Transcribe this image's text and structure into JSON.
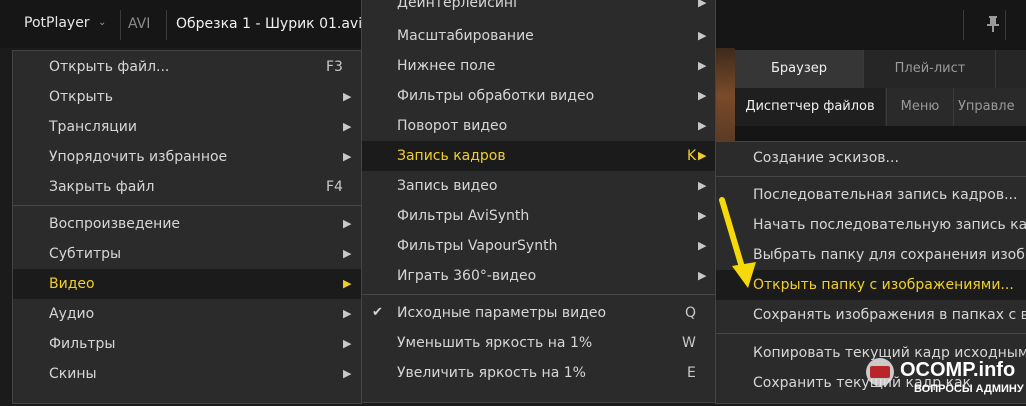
{
  "app": {
    "name": "PotPlayer",
    "format": "AVI",
    "title": "Обрезка 1 - Шурик 01.avi"
  },
  "main_menu": [
    {
      "label": "Открыть файл...",
      "shortcut": "F3",
      "arrow": ""
    },
    {
      "label": "Открыть",
      "shortcut": "",
      "arrow": "▶"
    },
    {
      "label": "Трансляции",
      "shortcut": "",
      "arrow": "▶"
    },
    {
      "label": "Упорядочить избранное",
      "shortcut": "",
      "arrow": "▶"
    },
    {
      "label": "Закрыть файл",
      "shortcut": "F4",
      "arrow": ""
    },
    {
      "label": "Воспроизведение",
      "shortcut": "",
      "arrow": "▶"
    },
    {
      "label": "Субтитры",
      "shortcut": "",
      "arrow": "▶"
    },
    {
      "label": "Видео",
      "shortcut": "",
      "arrow": "▶"
    },
    {
      "label": "Аудио",
      "shortcut": "",
      "arrow": "▶"
    },
    {
      "label": "Фильтры",
      "shortcut": "",
      "arrow": "▶"
    },
    {
      "label": "Скины",
      "shortcut": "",
      "arrow": "▶"
    }
  ],
  "video_menu": [
    {
      "label": "Деинтерлейсинг",
      "shortcut": "",
      "arrow": "▶"
    },
    {
      "label": "Масштабирование",
      "shortcut": "",
      "arrow": "▶"
    },
    {
      "label": "Нижнее поле",
      "shortcut": "",
      "arrow": "▶"
    },
    {
      "label": "Фильтры обработки видео",
      "shortcut": "",
      "arrow": "▶"
    },
    {
      "label": "Поворот видео",
      "shortcut": "",
      "arrow": "▶"
    },
    {
      "label": "Запись кадров",
      "shortcut": "K",
      "arrow": "▶"
    },
    {
      "label": "Запись видео",
      "shortcut": "",
      "arrow": "▶"
    },
    {
      "label": "Фильтры AviSynth",
      "shortcut": "",
      "arrow": "▶"
    },
    {
      "label": "Фильтры VapourSynth",
      "shortcut": "",
      "arrow": "▶"
    },
    {
      "label": "Играть 360°-видео",
      "shortcut": "",
      "arrow": "▶"
    },
    {
      "label": "Исходные параметры видео",
      "shortcut": "Q",
      "arrow": "",
      "checked": "✔"
    },
    {
      "label": "Уменьшить яркость на 1%",
      "shortcut": "W",
      "arrow": ""
    },
    {
      "label": "Увеличить яркость на 1%",
      "shortcut": "E",
      "arrow": ""
    }
  ],
  "frame_menu": [
    {
      "label": "Создание эскизов..."
    },
    {
      "label": "Последовательная запись кадров..."
    },
    {
      "label": "Начать последовательную запись кадров"
    },
    {
      "label": "Выбрать папку для сохранения изображений"
    },
    {
      "label": "Открыть папку с изображениями..."
    },
    {
      "label": "Сохранять изображения в папках с видео"
    },
    {
      "label": "Копировать текущий кадр исходным"
    },
    {
      "label": "Сохранить текущий кадр как"
    }
  ],
  "panel": {
    "tabs": [
      "Браузер",
      "Плей-лист"
    ],
    "subtabs": [
      "Диспетчер файлов",
      "Меню",
      "Управле"
    ]
  },
  "watermark": {
    "brand": "OCOMP.info",
    "tagline": "ВОПРОСЫ АДМИНУ"
  },
  "colors": {
    "highlight_text": "#f0cf2a",
    "arrow": "#f5d90a",
    "menu_bg": "#2b2b2b"
  }
}
